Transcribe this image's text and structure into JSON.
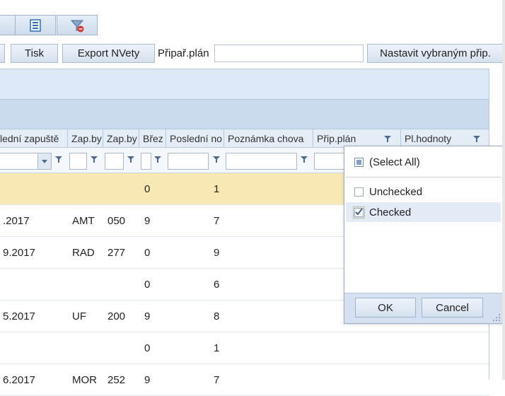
{
  "toolbar_icons": [
    "export-icon",
    "clear-filter-icon"
  ],
  "toolbar": {
    "print_label": "Tisk",
    "export_label": "Export NVety",
    "plan_label": "Připař.plán",
    "plan_value": "",
    "set_selected_label": "Nastavit vybraným přip."
  },
  "columns": [
    {
      "label": "lední zapuště"
    },
    {
      "label": "Zap.by"
    },
    {
      "label": "Zap.by"
    },
    {
      "label": "Břez"
    },
    {
      "label": "Poslední no"
    },
    {
      "label": "Poznámka chova"
    },
    {
      "label": "Přip.plán"
    },
    {
      "label": "Pl.hodnoty"
    }
  ],
  "rows": [
    {
      "date": "",
      "code": "",
      "num": "",
      "b": "0",
      "n": "1"
    },
    {
      "date": ".2017",
      "code": "AMT",
      "num": "050",
      "b": "9",
      "n": "7"
    },
    {
      "date": "9.2017",
      "code": "RAD",
      "num": "277",
      "b": "0",
      "n": "9"
    },
    {
      "date": "",
      "code": "",
      "num": "",
      "b": "0",
      "n": "6"
    },
    {
      "date": "5.2017",
      "code": "UF",
      "num": "200",
      "b": "9",
      "n": "8"
    },
    {
      "date": "",
      "code": "",
      "num": "",
      "b": "0",
      "n": "1"
    },
    {
      "date": "6.2017",
      "code": "MOR",
      "num": "252",
      "b": "9",
      "n": "7"
    }
  ],
  "filter_popup": {
    "select_all": "(Select All)",
    "options": [
      {
        "label": "Unchecked",
        "checked": false
      },
      {
        "label": "Checked",
        "checked": true
      }
    ],
    "ok_label": "OK",
    "cancel_label": "Cancel"
  }
}
